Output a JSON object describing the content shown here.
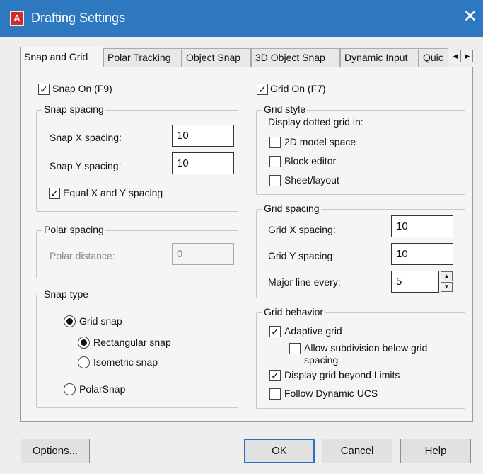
{
  "window": {
    "title": "Drafting Settings",
    "app_icon_letter": "A",
    "close_glyph": "✕"
  },
  "tabs": [
    "Snap and Grid",
    "Polar Tracking",
    "Object Snap",
    "3D Object Snap",
    "Dynamic Input",
    "Quic"
  ],
  "tab_scroll": {
    "left": "◀",
    "right": "▶"
  },
  "snap": {
    "snap_on_label": "Snap On (F9)",
    "snap_on_checked": true,
    "spacing": {
      "title": "Snap spacing",
      "x_label": "Snap X spacing:",
      "x_value": "10",
      "y_label": "Snap Y spacing:",
      "y_value": "10",
      "equal_label": "Equal X and Y spacing",
      "equal_checked": true
    },
    "polar": {
      "title": "Polar spacing",
      "distance_label": "Polar distance:",
      "distance_value": "0"
    },
    "type": {
      "title": "Snap type",
      "grid_snap_label": "Grid snap",
      "rect_label": "Rectangular snap",
      "iso_label": "Isometric snap",
      "polar_label": "PolarSnap",
      "selected_main": "grid",
      "selected_sub": "rectangular"
    }
  },
  "grid": {
    "grid_on_label": "Grid On (F7)",
    "grid_on_checked": true,
    "style": {
      "title": "Grid style",
      "caption": "Display dotted grid in:",
      "model_label": "2D model space",
      "block_label": "Block editor",
      "sheet_label": "Sheet/layout"
    },
    "spacing": {
      "title": "Grid spacing",
      "x_label": "Grid X spacing:",
      "x_value": "10",
      "y_label": "Grid Y spacing:",
      "y_value": "10",
      "major_label": "Major line every:",
      "major_value": "5"
    },
    "behavior": {
      "title": "Grid behavior",
      "adaptive_label": "Adaptive grid",
      "subdivision_label_line1": "Allow subdivision below grid",
      "subdivision_label_line2": "spacing",
      "beyond_label": "Display grid beyond Limits",
      "dynamic_ucs_label": "Follow Dynamic UCS"
    }
  },
  "buttons": {
    "options": "Options...",
    "ok": "OK",
    "cancel": "Cancel",
    "help": "Help"
  },
  "glyphs": {
    "check": "✓",
    "spin_up": "▲",
    "spin_down": "▼"
  },
  "colors": {
    "titlebar": "#2d78bf",
    "app_icon": "#d42a2a",
    "default_button_border": "#2d6fb8"
  }
}
